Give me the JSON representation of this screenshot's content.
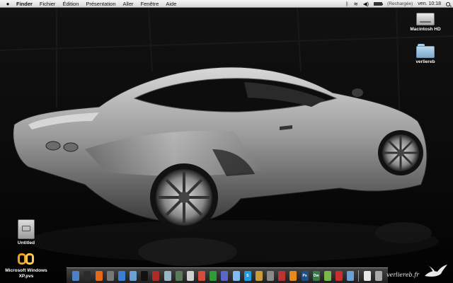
{
  "menubar": {
    "apple_label": "",
    "items": [
      "Finder",
      "Fichier",
      "Édition",
      "Présentation",
      "Aller",
      "Fenêtre",
      "Aide"
    ],
    "status": {
      "battery_text": "(Rechargée)",
      "clock": "ven. 10:18",
      "icons": [
        "bluetooth-icon",
        "wifi-icon",
        "volume-icon",
        "battery-icon",
        "spotlight-icon"
      ]
    }
  },
  "desktop": {
    "icons": [
      {
        "name": "macintosh-hd",
        "label": "Macintosh HD"
      },
      {
        "name": "verliereb",
        "label": "verliereb"
      },
      {
        "name": "untitled",
        "label": "Untitled"
      },
      {
        "name": "microsoft-windows-pvs",
        "label": "Microsoft Windows XP.pvs"
      }
    ]
  },
  "dock": {
    "items": [
      {
        "name": "finder",
        "color": "#4f7fc4",
        "glyph": ""
      },
      {
        "name": "dashboard",
        "color": "#2b2b2b",
        "glyph": ""
      },
      {
        "name": "firefox",
        "color": "#e56a16",
        "glyph": ""
      },
      {
        "name": "system-preferences",
        "color": "#777777",
        "glyph": ""
      },
      {
        "name": "itunes",
        "color": "#3a7fd6",
        "glyph": ""
      },
      {
        "name": "mail",
        "color": "#6aa0d8",
        "glyph": ""
      },
      {
        "name": "terminal",
        "color": "#111111",
        "glyph": ""
      },
      {
        "name": "photo-booth",
        "color": "#b02a2a",
        "glyph": ""
      },
      {
        "name": "preview",
        "color": "#9bb4c8",
        "glyph": ""
      },
      {
        "name": "time-machine",
        "color": "#5a7a5a",
        "glyph": ""
      },
      {
        "name": "text-edit",
        "color": "#cfcfcf",
        "glyph": ""
      },
      {
        "name": "ical",
        "color": "#d44b3c",
        "glyph": ""
      },
      {
        "name": "adium",
        "color": "#2f9c3a",
        "glyph": ""
      },
      {
        "name": "textwrangler",
        "color": "#5b66c9",
        "glyph": ""
      },
      {
        "name": "ichat",
        "color": "#7fbaf0",
        "glyph": ""
      },
      {
        "name": "skype",
        "color": "#1e9ee0",
        "glyph": "S"
      },
      {
        "name": "cyberduck",
        "color": "#c79c3b",
        "glyph": ""
      },
      {
        "name": "automator",
        "color": "#8a8a8a",
        "glyph": ""
      },
      {
        "name": "transmission",
        "color": "#b33",
        "glyph": ""
      },
      {
        "name": "vlc",
        "color": "#e88a1b",
        "glyph": ""
      },
      {
        "name": "photoshop",
        "color": "#1d4f88",
        "glyph": "Ps"
      },
      {
        "name": "dreamweaver",
        "color": "#3a7a4a",
        "glyph": "Dw"
      },
      {
        "name": "coda",
        "color": "#7ab84a",
        "glyph": ""
      },
      {
        "name": "parallels",
        "color": "#c9302c",
        "glyph": ""
      },
      {
        "name": "applications-folder",
        "color": "#6d9fd0",
        "glyph": ""
      },
      {
        "name": "documents-stack",
        "color": "#e8e8e8",
        "glyph": ""
      },
      {
        "name": "trash",
        "color": "#a9a9a9",
        "glyph": ""
      }
    ]
  },
  "watermark": {
    "text": "verliereb.fr"
  },
  "colors": {
    "menubar": "#e6e6e6",
    "desktop_bg": "#060606",
    "car_body": "#b8b8b8"
  }
}
